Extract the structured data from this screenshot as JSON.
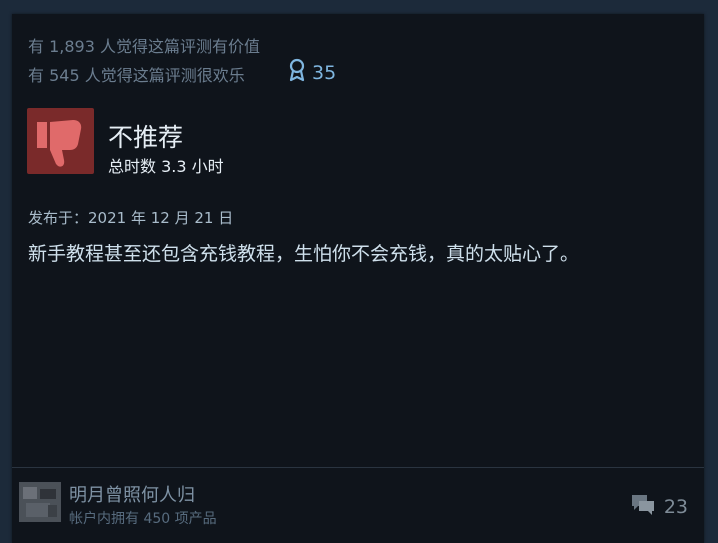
{
  "helpful": {
    "helpful_text": "有 1,893 人觉得这篇评测有价值",
    "funny_text": "有 545 人觉得这篇评测很欢乐",
    "award_count": "35",
    "award_icon": "award-ribbon-icon"
  },
  "review": {
    "recommendation": "不推荐",
    "hours": "总时数 3.3 小时",
    "posted": "发布于：2021 年 12 月 21 日",
    "text": "新手教程甚至还包含充钱教程，生怕你不会充钱，真的太贴心了。",
    "icon": "thumbs-down-icon",
    "icon_bg_color": "#7a2a2a",
    "icon_color": "#e06a6a"
  },
  "author": {
    "name": "明月曾照何人归",
    "products": "帐户内拥有 450 项产品",
    "comment_count": "23",
    "comment_icon": "comment-bubbles-icon"
  },
  "colors": {
    "background": "#1c2a3a",
    "card": "#0f141b",
    "accent": "#7fb6e0"
  }
}
